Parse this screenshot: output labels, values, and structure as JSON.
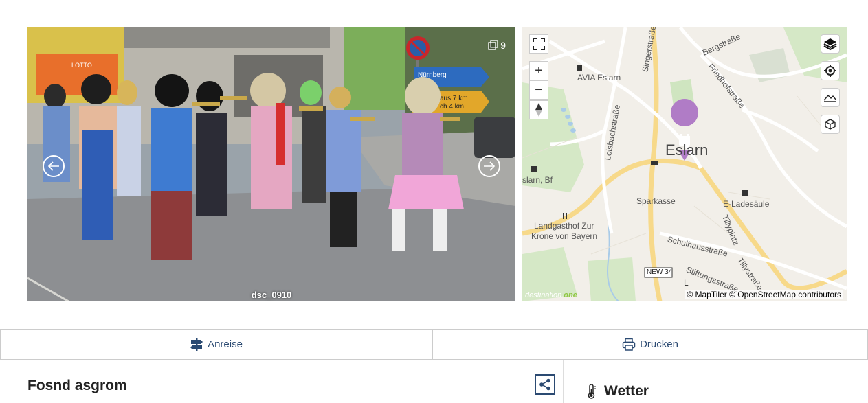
{
  "gallery": {
    "caption": "dsc_0910",
    "image_count": "9",
    "sign_text_1": "Nürnberg",
    "sign_text_2": "aus 7 km",
    "sign_text_3": "ch 4 km",
    "shop_sign": "LOTTO"
  },
  "map": {
    "town_label": "Eslarn",
    "labels": {
      "avia": "AVIA Eslarn",
      "sparkasse": "Sparkasse",
      "e_ladesaeule": "E-Ladesäule",
      "bf": "slarn, Bf",
      "landgasthof_1": "Landgasthof Zur",
      "landgasthof_2": "Krone von Bayern",
      "bergstrasse": "Bergstraße",
      "friedhofstrasse": "Friedhofstraße",
      "singerstrasse": "Singerstraße",
      "loisbachstrasse": "Loisbachstraße",
      "schulhausstrasse": "Schulhausstraße",
      "tillyplatz": "Tillyplatz",
      "tillystrasse": "Tillystraße",
      "stiftungsstrasse": "Stiftungsstraße",
      "new34": "NEW 34",
      "l": "L"
    },
    "attribution": "© MapTiler © OpenStreetMap contributors",
    "logo_main": "destination.",
    "logo_accent": "one",
    "zoom_in": "+",
    "zoom_out": "−"
  },
  "actions": {
    "arrival_label": "Anreise",
    "print_label": "Drucken"
  },
  "event": {
    "title": "Fosnd asgrom"
  },
  "weather": {
    "title": "Wetter"
  },
  "colors": {
    "accent": "#2b4a72",
    "marker": "#b07cc6"
  }
}
